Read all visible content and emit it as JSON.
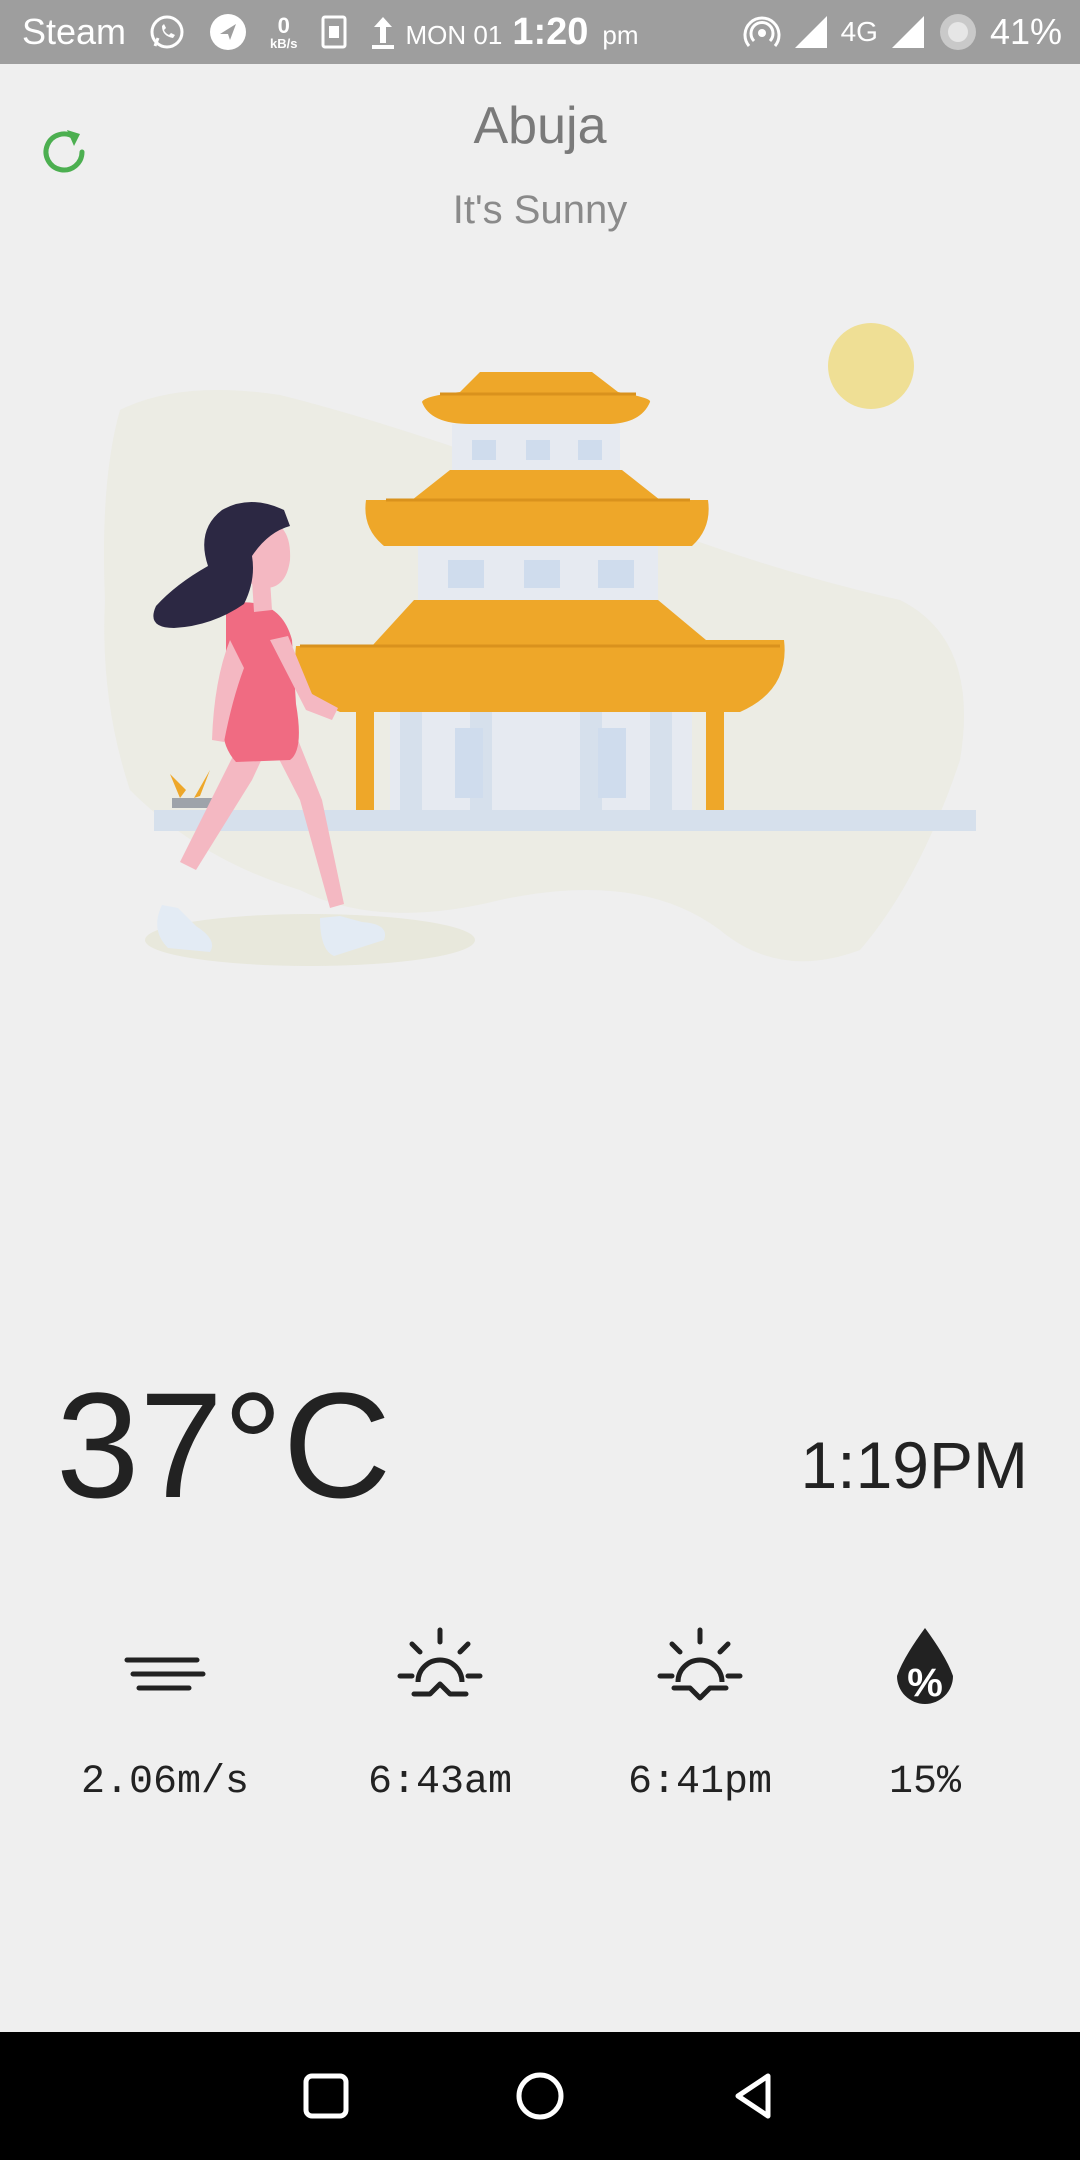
{
  "status_bar": {
    "carrier": "Steam",
    "speed_value": "0",
    "speed_unit": "kB/s",
    "day": "MON 01",
    "time": "1:20",
    "time_suffix": "pm",
    "network": "4G",
    "battery": "41%"
  },
  "header": {
    "city": "Abuja",
    "description": "It's Sunny"
  },
  "weather": {
    "temperature": "37°C",
    "local_time": "1:19PM",
    "stats": [
      {
        "icon": "wind-icon",
        "value": "2.06m/s"
      },
      {
        "icon": "sunrise-icon",
        "value": "6:43am"
      },
      {
        "icon": "sunset-icon",
        "value": "6:41pm"
      },
      {
        "icon": "humidity-icon",
        "value": "15%"
      }
    ]
  },
  "colors": {
    "accent": "#4caf50",
    "pagoda": "#eea729",
    "dress": "#f06b82",
    "sun": "#efdf95"
  }
}
